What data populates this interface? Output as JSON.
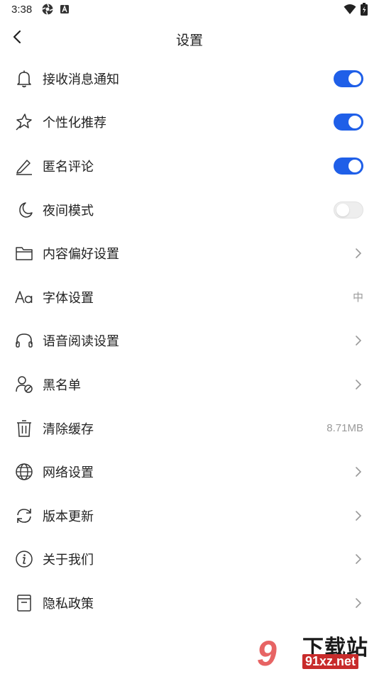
{
  "status_bar": {
    "time": "3:38",
    "left_icons": [
      "settings-cog-icon",
      "a-badge-icon"
    ],
    "right_icons": [
      "wifi-icon",
      "battery-charging-icon"
    ]
  },
  "header": {
    "back_icon": "chevron-left-icon",
    "title": "设置"
  },
  "colors": {
    "toggle_on": "#1f5fe8",
    "toggle_off": "#eeeeee",
    "value_gray": "#9a9a9a",
    "text": "#222222"
  },
  "settings": [
    {
      "icon": "bell-icon",
      "label": "接收消息通知",
      "control": "toggle",
      "state": "on"
    },
    {
      "icon": "sparkle-star-icon",
      "label": "个性化推荐",
      "control": "toggle",
      "state": "on"
    },
    {
      "icon": "pencil-icon",
      "label": "匿名评论",
      "control": "toggle",
      "state": "on"
    },
    {
      "icon": "moon-icon",
      "label": "夜间模式",
      "control": "toggle",
      "state": "off"
    },
    {
      "icon": "folder-icon",
      "label": "内容偏好设置",
      "control": "chevron"
    },
    {
      "icon": "font-aa-icon",
      "label": "字体设置",
      "control": "value",
      "value": "中"
    },
    {
      "icon": "headphones-icon",
      "label": "语音阅读设置",
      "control": "chevron"
    },
    {
      "icon": "user-blocked-icon",
      "label": "黑名单",
      "control": "chevron"
    },
    {
      "icon": "trash-icon",
      "label": "清除缓存",
      "control": "value",
      "value": "8.71MB"
    },
    {
      "icon": "globe-icon",
      "label": "网络设置",
      "control": "chevron"
    },
    {
      "icon": "refresh-icon",
      "label": "版本更新",
      "control": "chevron"
    },
    {
      "icon": "info-icon",
      "label": "关于我们",
      "control": "chevron"
    },
    {
      "icon": "document-icon",
      "label": "隐私政策",
      "control": "chevron"
    }
  ],
  "watermark": {
    "logo": "9",
    "top_text": "下载站",
    "bottom_text": "91xz.net"
  }
}
